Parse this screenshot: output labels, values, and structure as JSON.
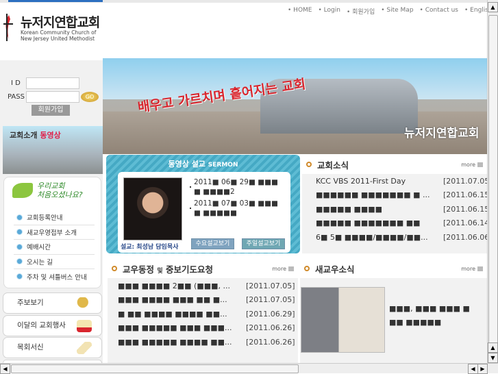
{
  "header": {
    "logo_name": "뉴저지연합교회",
    "logo_sub_1": "Korean Community Church of",
    "logo_sub_2": "New Jersey United Methodist",
    "nav": [
      "HOME",
      "Login",
      "회원가입",
      "Site Map",
      "Contact us",
      "English M"
    ]
  },
  "banner": {
    "slogan": "배우고 가르치며 흩어지는 교회",
    "logo": "뉴저지연합교회"
  },
  "login": {
    "id_label": "I D",
    "pass_label": "PASS",
    "go_label": "GO",
    "join_label": "회원가입"
  },
  "video_banner": {
    "title": "교회소개",
    "highlight": "동영상"
  },
  "welcome": {
    "heading_1": "우리교회",
    "heading_2": "처음오셨나요?",
    "items": [
      "교회등록안내",
      "새교우영접부 소개",
      "예배시간",
      "오시는 길",
      "주차 및 셔틀버스 안내"
    ]
  },
  "quick_buttons": [
    "주보보기",
    "이달의 교회행사",
    "목회서신"
  ],
  "sermon": {
    "title": "동영상 설교",
    "title_en": "SERMON",
    "caption": "설교: 최성남 담임목사",
    "items": [
      "2011■ 06■ 29■ ■■■ ■ ■■■■2",
      "2011■ 07■ 03■ ■■■ ■ ■■■■■"
    ],
    "wed_button": "수요설교보기",
    "sun_button": "주일설교보기"
  },
  "news": {
    "title": "교회소식",
    "more": "more",
    "rows": [
      {
        "title": "KCC VBS 2011-First Day",
        "date": "[2011.07.05]"
      },
      {
        "title": "■■■■■■ ■■■■■■■ ■ ...",
        "date": "[2011.06.15]"
      },
      {
        "title": "■■■■■ ■■■■",
        "date": "[2011.06.15]"
      },
      {
        "title": "■■■■■ ■■■■■■■ ■■",
        "date": "[2011.06.14]"
      },
      {
        "title": "6■ 5■ ■■■■/■■■■/■■...",
        "date": "[2011.06.06]"
      }
    ]
  },
  "prayer": {
    "title": "교우동정",
    "title_mid": "및",
    "title_end": "중보기도요청",
    "more": "more",
    "rows": [
      {
        "title": "■■■ ■■■■ 2■■ (■■■, ...",
        "date": "[2011.07.05]"
      },
      {
        "title": "■■■ ■■■■ ■■■ ■■ ■...",
        "date": "[2011.07.05]"
      },
      {
        "title": "■ ■■ ■■■■ ■■■■ ■■...",
        "date": "[2011.06.29]"
      },
      {
        "title": "■■■ ■■■■■ ■■■ ■■■...",
        "date": "[2011.06.26]"
      },
      {
        "title": "■■■ ■■■■■ ■■■■ ■■...",
        "date": "[2011.06.26]"
      }
    ]
  },
  "new_members": {
    "title": "새교우소식",
    "more": "more",
    "text": "■■■, ■■■ ■■■ ■ ■■ ■■■■■"
  }
}
